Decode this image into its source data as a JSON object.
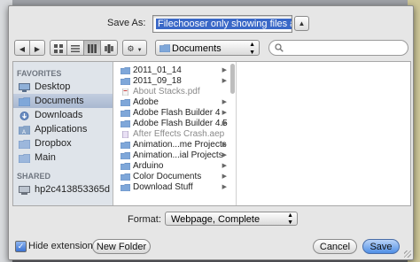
{
  "header": {
    "save_as_label": "Save As:",
    "filename_value": "Filechooser only showing files and nos",
    "expand_glyph": "▲"
  },
  "toolbar": {
    "back_glyph": "◀",
    "forward_glyph": "▶",
    "arrange_glyph": "⚙",
    "current_folder": "Documents"
  },
  "sidebar": {
    "favorites_heading": "FAVORITES",
    "shared_heading": "SHARED",
    "favorites": [
      {
        "label": "Desktop",
        "icon": "desktop-icon",
        "selected": false
      },
      {
        "label": "Documents",
        "icon": "documents-icon",
        "selected": true
      },
      {
        "label": "Downloads",
        "icon": "downloads-icon",
        "selected": false
      },
      {
        "label": "Applications",
        "icon": "applications-icon",
        "selected": false
      },
      {
        "label": "Dropbox",
        "icon": "folder-icon",
        "selected": false
      },
      {
        "label": "Main",
        "icon": "folder-icon",
        "selected": false
      }
    ],
    "shared": [
      {
        "label": "hp2c413853365d",
        "icon": "computer-icon"
      }
    ]
  },
  "files": [
    {
      "name": "2011_01_14",
      "kind": "folder",
      "dim": false
    },
    {
      "name": "2011_09_18",
      "kind": "folder",
      "dim": false
    },
    {
      "name": "About Stacks.pdf",
      "kind": "pdf",
      "dim": true
    },
    {
      "name": "Adobe",
      "kind": "folder",
      "dim": false
    },
    {
      "name": "Adobe Flash Builder 4",
      "kind": "folder",
      "dim": false
    },
    {
      "name": "Adobe Flash Builder 4.5",
      "kind": "folder",
      "dim": false
    },
    {
      "name": "After Effects Crash.aep",
      "kind": "doc",
      "dim": true
    },
    {
      "name": "Animation...me Projects",
      "kind": "folder",
      "dim": false
    },
    {
      "name": "Animation...ial Projects",
      "kind": "folder",
      "dim": false
    },
    {
      "name": "Arduino",
      "kind": "folder",
      "dim": false
    },
    {
      "name": "Color Documents",
      "kind": "folder",
      "dim": false
    },
    {
      "name": "Download Stuff",
      "kind": "folder",
      "dim": false
    }
  ],
  "format": {
    "label": "Format:",
    "selected": "Webpage, Complete"
  },
  "bottom": {
    "hide_extension_label": "Hide extension",
    "hide_extension_checked": true,
    "new_folder_label": "New Folder",
    "cancel_label": "Cancel",
    "save_label": "Save"
  },
  "colors": {
    "selection_blue": "#3a68c7",
    "sidebar_bg": "#dfe4ea",
    "folder_blue": "#7fa7d9"
  }
}
